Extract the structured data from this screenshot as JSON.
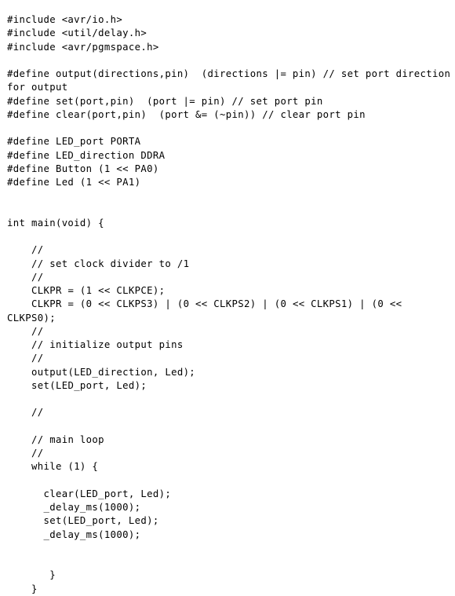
{
  "document": {
    "kind": "plain-text-source-listing",
    "language": "C",
    "background_color": "#ffffff",
    "text_color": "#000000",
    "wrap_mode": "soft-wrap-to-left-margin",
    "lines": [
      "#include <avr/io.h>",
      "#include <util/delay.h>",
      "#include <avr/pgmspace.h>",
      "",
      "#define output(directions,pin)  (directions |= pin) // set port direction for output",
      "#define set(port,pin)  (port |= pin) // set port pin",
      "#define clear(port,pin)  (port &= (~pin)) // clear port pin",
      "",
      "#define LED_port PORTA",
      "#define LED_direction DDRA",
      "#define Button (1 << PA0)",
      "#define Led (1 << PA1)",
      "",
      "",
      "int main(void) {",
      "",
      "    //",
      "    // set clock divider to /1",
      "    //",
      "    CLKPR = (1 << CLKPCE);",
      "    CLKPR = (0 << CLKPS3) | (0 << CLKPS2) | (0 << CLKPS1) | (0 << CLKPS0);",
      "    //",
      "    // initialize output pins",
      "    //",
      "    output(LED_direction, Led);",
      "    set(LED_port, Led);",
      "",
      "    //",
      "",
      "    // main loop",
      "    //",
      "    while (1) {",
      "",
      "      clear(LED_port, Led);",
      "      _delay_ms(1000);",
      "      set(LED_port, Led);",
      "      _delay_ms(1000);",
      "",
      "",
      "       }",
      "    }"
    ]
  }
}
